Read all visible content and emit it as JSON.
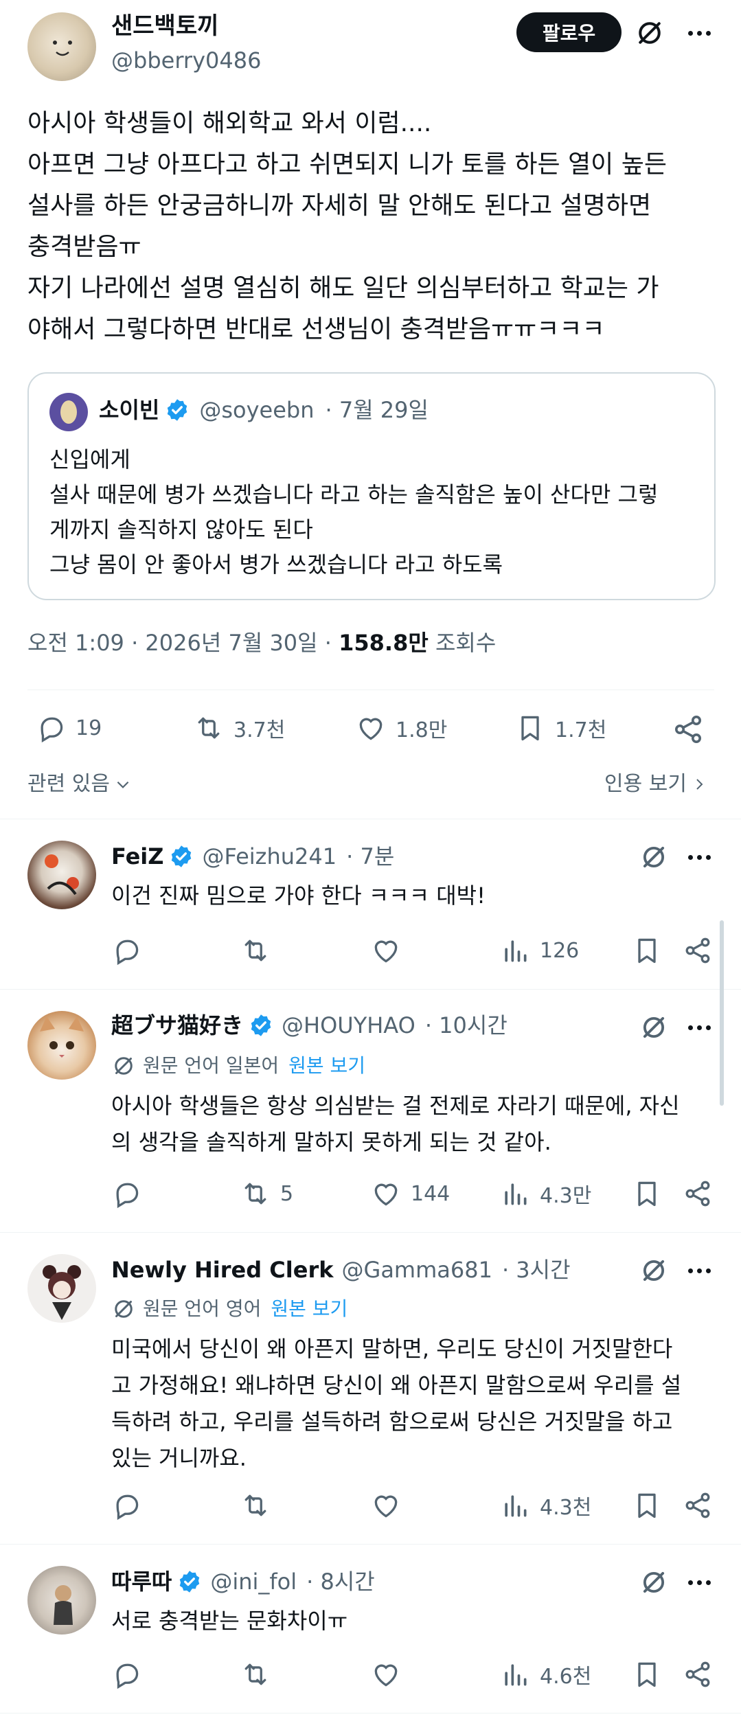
{
  "colors": {
    "accent": "#1d9bf0",
    "text": "#0f1419",
    "muted": "#536471",
    "border": "#cfd9de"
  },
  "main_post": {
    "display_name": "샌드백토끼",
    "handle": "@bberry0486",
    "follow_label": "팔로우",
    "text": "아시아 학생들이 해외학교 와서 이럼....\n아프면 그냥 아프다고 하고 쉬면되지 니가 토를 하든 열이 높든\n설사를 하든 안궁금하니까 자세히 말 안해도 된다고 설명하면\n충격받음ㅠ\n자기 나라에선 설명 열심히 해도 일단 의심부터하고 학교는 가\n야해서 그렇다하면 반대로 선생님이 충격받음ㅠㅠㅋㅋㅋ",
    "quote": {
      "display_name": "소이빈",
      "handle": "@soyeebn",
      "date": "· 7월 29일",
      "text": "신입에게\n설사 때문에 병가 쓰겠습니다 라고 하는 솔직함은 높이 산다만 그렇\n게까지 솔직하지 않아도 된다\n그냥 몸이 안 좋아서 병가 쓰겠습니다 라고 하도록"
    },
    "meta": {
      "time": "오전 1:09 · 2026년 7월 30일 · ",
      "views": "158.8만",
      "views_label": " 조회수"
    },
    "stats": {
      "replies": "19",
      "reposts": "3.7천",
      "likes": "1.8만",
      "bookmarks": "1.7천"
    },
    "related_label": "관련 있음",
    "quotes_label": "인용 보기"
  },
  "replies": [
    {
      "display_name": "FeiZ",
      "handle": "@Feizhu241",
      "time": "· 7분",
      "text": "이건 진짜 밈으로 가야 한다 ㅋㅋㅋ 대박!",
      "reposts": "",
      "likes": "",
      "views": "126"
    },
    {
      "display_name": "超ブサ猫好き",
      "handle": "@HOUYHAO",
      "time": "· 10시간",
      "translation_label": "원문 언어 일본어",
      "show_original": "원본 보기",
      "text": "아시아 학생들은 항상 의심받는 걸 전제로 자라기 때문에, 자신\n의 생각을 솔직하게 말하지 못하게 되는 것 같아.",
      "reposts": "5",
      "likes": "144",
      "views": "4.3만"
    },
    {
      "display_name": "Newly Hired Clerk",
      "handle": "@Gamma681",
      "time": "· 3시간",
      "translation_label": "원문 언어 영어",
      "show_original": "원본 보기",
      "text": "미국에서 당신이 왜 아픈지 말하면, 우리도 당신이 거짓말한다\n고 가정해요! 왜냐하면 당신이 왜 아픈지 말함으로써 우리를 설\n득하려 하고, 우리를 설득하려 함으로써 당신은 거짓말을 하고\n있는 거니까요.",
      "reposts": "",
      "likes": "",
      "views": "4.3천"
    },
    {
      "display_name": "따루따",
      "handle": "@ini_fol",
      "time": "· 8시간",
      "text": "서로 충격받는 문화차이ㅠ",
      "reposts": "",
      "likes": "",
      "views": "4.6천"
    }
  ]
}
